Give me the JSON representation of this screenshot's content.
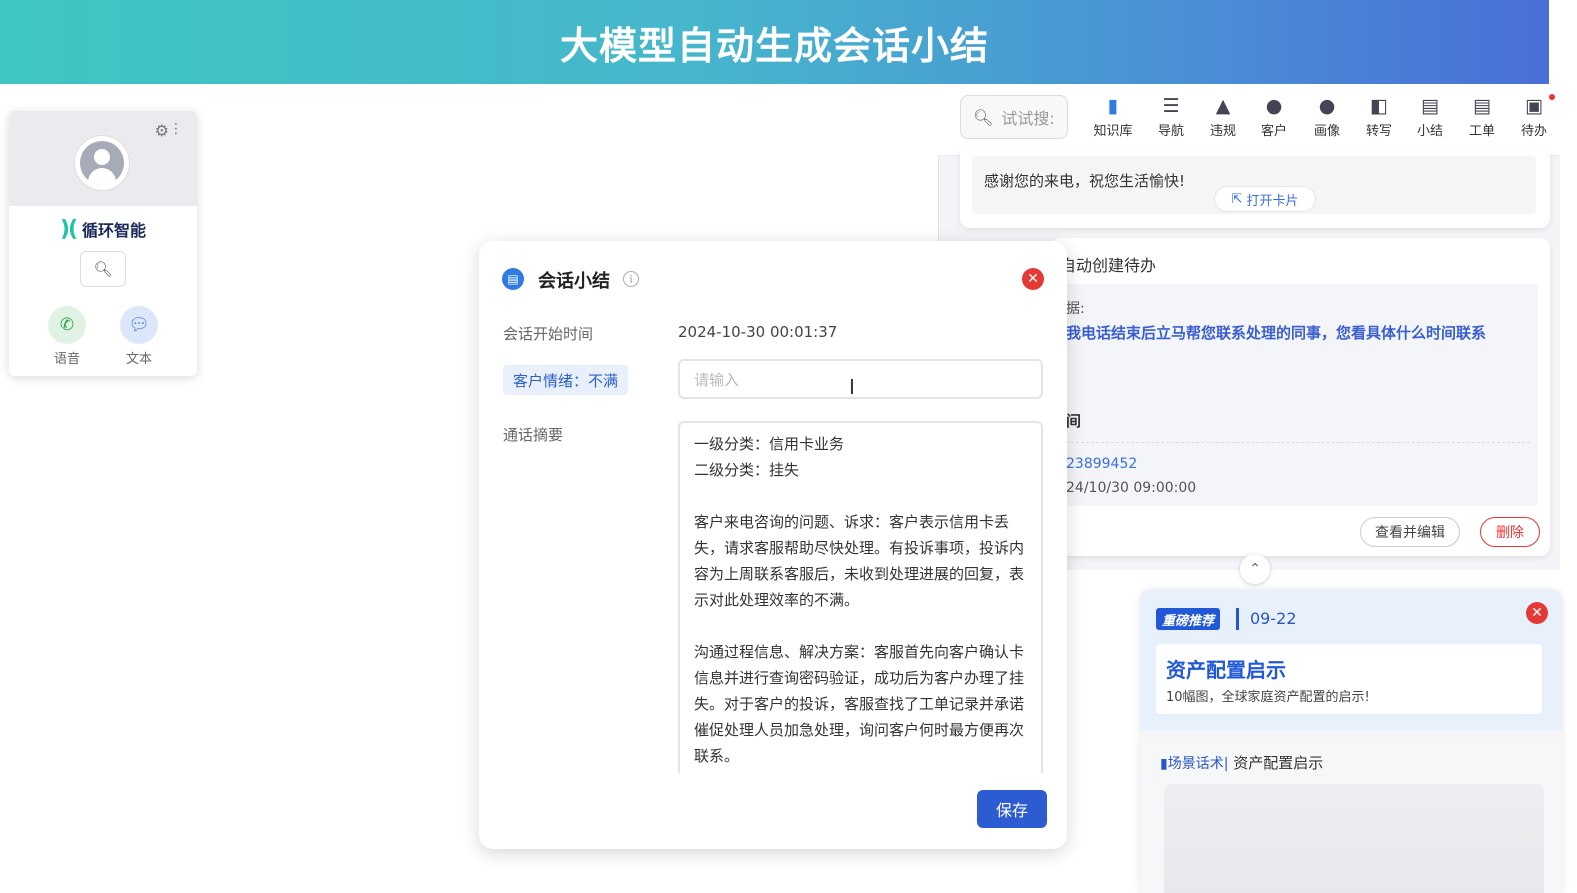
{
  "banner": {
    "title": "大模型自动生成会话小结"
  },
  "widget": {
    "brand_logo": ")(",
    "brand_name": "循环智能",
    "voice_label": "语音",
    "text_label": "文本"
  },
  "toolbar": {
    "search_placeholder": "试试搜:",
    "items": [
      {
        "label": "知识库",
        "icon": "book-icon"
      },
      {
        "label": "导航",
        "icon": "list-icon"
      },
      {
        "label": "违规",
        "icon": "warning-icon"
      },
      {
        "label": "客户",
        "icon": "user-check-icon"
      },
      {
        "label": "画像",
        "icon": "profile-icon"
      },
      {
        "label": "转写",
        "icon": "transcribe-icon"
      },
      {
        "label": "小结",
        "icon": "summary-icon"
      },
      {
        "label": "工单",
        "icon": "ticket-icon"
      },
      {
        "label": "待办",
        "icon": "todo-icon"
      }
    ]
  },
  "card1": {
    "text": "感谢您的来电，祝您生活愉快!",
    "open_card": "打开卡片"
  },
  "card2": {
    "title": "自动创建待办",
    "basis_label": "据:",
    "quote": "我电话结束后立马帮您联系处理的同事，您看具体什么时间联系",
    "time_label": "间",
    "phone": "23899452",
    "date": "24/10/30 09:00:00",
    "edit_button": "查看并编辑",
    "delete_button": "删除"
  },
  "recommend": {
    "tag": "重磅推荐",
    "date": "09-22",
    "title": "资产配置启示",
    "subtitle": "10幅图，全球家庭资产配置的启示!",
    "section_tag": "场景话术|",
    "section_title": "资产配置启示"
  },
  "dialog": {
    "title": "会话小结",
    "start_time_label": "会话开始时间",
    "start_time_value": "2024-10-30 00:01:37",
    "emotion_tag": "客户情绪：不满",
    "input_placeholder": "请输入",
    "summary_label": "通话摘要",
    "summary": {
      "line1": "一级分类：信用卡业务",
      "line2": "二级分类：挂失",
      "para1": "客户来电咨询的问题、诉求：客户表示信用卡丢失，请求客服帮助尽快处理。有投诉事项，投诉内容为上周联系客服后，未收到处理进展的回复，表示对此处理效率的不满。",
      "para2": "沟通过程信息、解决方案：客服首先向客户确认卡信息并进行查询密码验证，成功后为客户办理了挂失。对于客户的投诉，客服查找了工单记录并承诺催促处理人员加急处理，询问客户何时最方便再次联系。"
    },
    "save_button": "保存"
  }
}
